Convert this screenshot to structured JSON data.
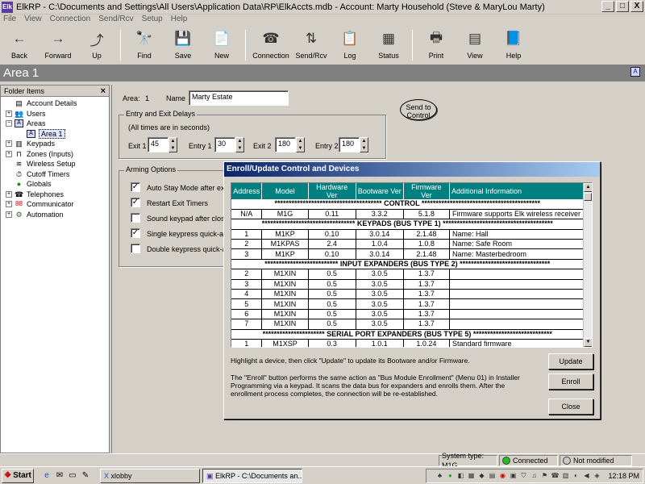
{
  "window": {
    "title": "ElkRP - C:\\Documents and Settings\\All Users\\Application Data\\RP\\ElkAccts.mdb - Account: Marty Household (Steve & MaryLou Marty)",
    "app_icon": "Elk",
    "min": "_",
    "max": "□",
    "close": "X"
  },
  "menu": [
    "File",
    "View",
    "Connection",
    "Send/Rcv",
    "Setup",
    "Help"
  ],
  "toolbar": [
    {
      "label": "Back",
      "icon": "←"
    },
    {
      "label": "Forward",
      "icon": "→"
    },
    {
      "label": "Up",
      "icon": "⤴"
    },
    {
      "label": "Find",
      "icon": "🔭"
    },
    {
      "label": "Save",
      "icon": "💾"
    },
    {
      "label": "New",
      "icon": "📄"
    },
    {
      "label": "Connection",
      "icon": "☎"
    },
    {
      "label": "Send/Rcv",
      "icon": "⇅"
    },
    {
      "label": "Log",
      "icon": "📋"
    },
    {
      "label": "Status",
      "icon": "▦"
    },
    {
      "label": "Print",
      "icon": "🖶"
    },
    {
      "label": "View",
      "icon": "▤"
    },
    {
      "label": "Help",
      "icon": "📘"
    }
  ],
  "area_bar": {
    "title": "Area 1",
    "icon": "A"
  },
  "folder_panel": {
    "title": "Folder Items",
    "close": "×",
    "items": [
      {
        "label": "Account Details",
        "icon": "▤"
      },
      {
        "label": "Users",
        "icon": "👥",
        "pm": "+"
      },
      {
        "label": "Areas",
        "icon": "A",
        "pm": "−"
      },
      {
        "label": "Area 1",
        "icon": "A"
      },
      {
        "label": "Keypads",
        "icon": "▥",
        "pm": "+"
      },
      {
        "label": "Zones (Inputs)",
        "icon": "⊓",
        "pm": "+"
      },
      {
        "label": "Wireless Setup",
        "icon": "≋"
      },
      {
        "label": "Cutoff Timers",
        "icon": "⏱"
      },
      {
        "label": "Globals",
        "icon": "●"
      },
      {
        "label": "Telephones",
        "icon": "☎",
        "pm": "+"
      },
      {
        "label": "Communicator",
        "icon": "88",
        "pm": "+"
      },
      {
        "label": "Automation",
        "icon": "⚙",
        "pm": "+"
      }
    ]
  },
  "area_form": {
    "area_label": "Area:",
    "area_value": "1",
    "name_label": "Name",
    "name_value": "Marty Estate",
    "send_btn_line1": "Send to",
    "send_btn_line2": "Control",
    "delays": {
      "title": "Entry and Exit Delays",
      "note": "(All times are in seconds)",
      "fields": [
        {
          "label": "Exit 1",
          "value": "45"
        },
        {
          "label": "Entry 1",
          "value": "30"
        },
        {
          "label": "Exit 2",
          "value": "180"
        },
        {
          "label": "Entry 2",
          "value": "180"
        }
      ]
    },
    "arming": {
      "title": "Arming Options",
      "options": [
        {
          "label": "Auto Stay Mode after exit",
          "checked": "✓"
        },
        {
          "label": "Restart Exit Timers",
          "checked": "✓"
        },
        {
          "label": "Sound keypad after closin",
          "checked": ""
        },
        {
          "label": "Single keypress quick-arm",
          "checked": "✓"
        },
        {
          "label": "Double keypress quick-arr",
          "checked": ""
        }
      ]
    }
  },
  "dialog": {
    "title": "Enroll/Update Control and Devices",
    "columns": [
      "Address",
      "Model",
      "Hardware Ver",
      "Bootware Ver",
      "Firmware Ver",
      "Additional Information"
    ],
    "rows": [
      {
        "section": "************************************** CONTROL ******************************************"
      },
      {
        "cells": [
          "N/A",
          "M1G",
          "0.11",
          "3.3.2",
          "5.1.8",
          "Firmware supports Elk wireless receiver"
        ]
      },
      {
        "section": "********************************* KEYPADS (BUS TYPE 1) ***************************************"
      },
      {
        "cells": [
          "1",
          "M1KP",
          "0.10",
          "3.0.14",
          "2.1.48",
          "Name: Hall"
        ]
      },
      {
        "cells": [
          "2",
          "M1KPAS",
          "2.4",
          "1.0.4",
          "1.0.8",
          "Name: Safe Room"
        ]
      },
      {
        "cells": [
          "3",
          "M1KP",
          "0.10",
          "3.0.14",
          "2.1.48",
          "Name: Masterbedroom"
        ]
      },
      {
        "section": "************************** INPUT EXPANDERS (BUS TYPE 2) ********************************"
      },
      {
        "cells": [
          "2",
          "M1XIN",
          "0.5",
          "3.0.5",
          "1.3.7",
          ""
        ]
      },
      {
        "cells": [
          "3",
          "M1XIN",
          "0.5",
          "3.0.5",
          "1.3.7",
          ""
        ]
      },
      {
        "cells": [
          "4",
          "M1XIN",
          "0.5",
          "3.0.5",
          "1.3.7",
          ""
        ]
      },
      {
        "cells": [
          "5",
          "M1XIN",
          "0.5",
          "3.0.5",
          "1.3.7",
          ""
        ]
      },
      {
        "cells": [
          "6",
          "M1XIN",
          "0.5",
          "3.0.5",
          "1.3.7",
          ""
        ]
      },
      {
        "cells": [
          "7",
          "M1XIN",
          "0.5",
          "3.0.5",
          "1.3.7",
          ""
        ]
      },
      {
        "section": "********************** SERIAL PORT EXPANDERS (BUS TYPE 5) ****************************"
      },
      {
        "cells": [
          "1",
          "M1XSP",
          "0.3",
          "1.0.1",
          "1.0.24",
          "Standard firmware"
        ]
      }
    ],
    "hint": "Highlight a device, then click \"Update\" to update its Bootware and/or Firmware.",
    "enroll_text": "The \"Enroll\" button performs the same action as \"Bus Module Enrollment\" (Menu 01) in Installer Programming via a keypad. It scans the data bus for expanders and enrolls them. After the enrollment process completes, the connection will be re-established.",
    "buttons": {
      "update": "Update",
      "enroll": "Enroll",
      "close": "Close"
    }
  },
  "statusbar": {
    "system_type": "System type: M1G",
    "connected": "Connected",
    "modified": "Not modified",
    "connected_color": "#22c022",
    "modified_color": "#c8c8c8"
  },
  "taskbar": {
    "start": "Start",
    "tasks": [
      {
        "label": "xlobby",
        "active": false
      },
      {
        "label": "ElkRP - C:\\Documents an...",
        "active": true
      }
    ],
    "clock": "12:18 PM"
  }
}
